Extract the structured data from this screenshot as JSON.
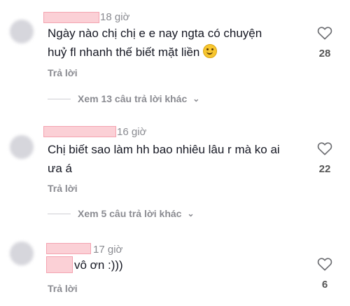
{
  "comments": [
    {
      "time": "18 giờ",
      "text": [
        "Ngày nào chị chị e e nay ngta có chuyện",
        "huỷ fl nhanh thế biết mặt liền"
      ],
      "emoji": "slightly-smiling-face",
      "reply_label": "Trả lời",
      "like_count": "28",
      "view_more": "Xem 13 câu trả lời khác"
    },
    {
      "time": "16 giờ",
      "text": [
        "Chị biết sao làm hh bao nhiêu lâu r mà ko ai",
        "ưa á"
      ],
      "reply_label": "Trả lời",
      "like_count": "22",
      "view_more": "Xem 5 câu trả lời khác"
    },
    {
      "time": "17 giờ",
      "text": [
        "vô ơn :)))"
      ],
      "reply_label": "Trả lời",
      "like_count": "6"
    }
  ],
  "icons": {
    "like": "heart-outline-icon",
    "expand": "chevron-down-icon"
  },
  "colors": {
    "redaction": "#fbd0d6",
    "muted_text": "#8a8b91",
    "main_text": "#161823"
  }
}
